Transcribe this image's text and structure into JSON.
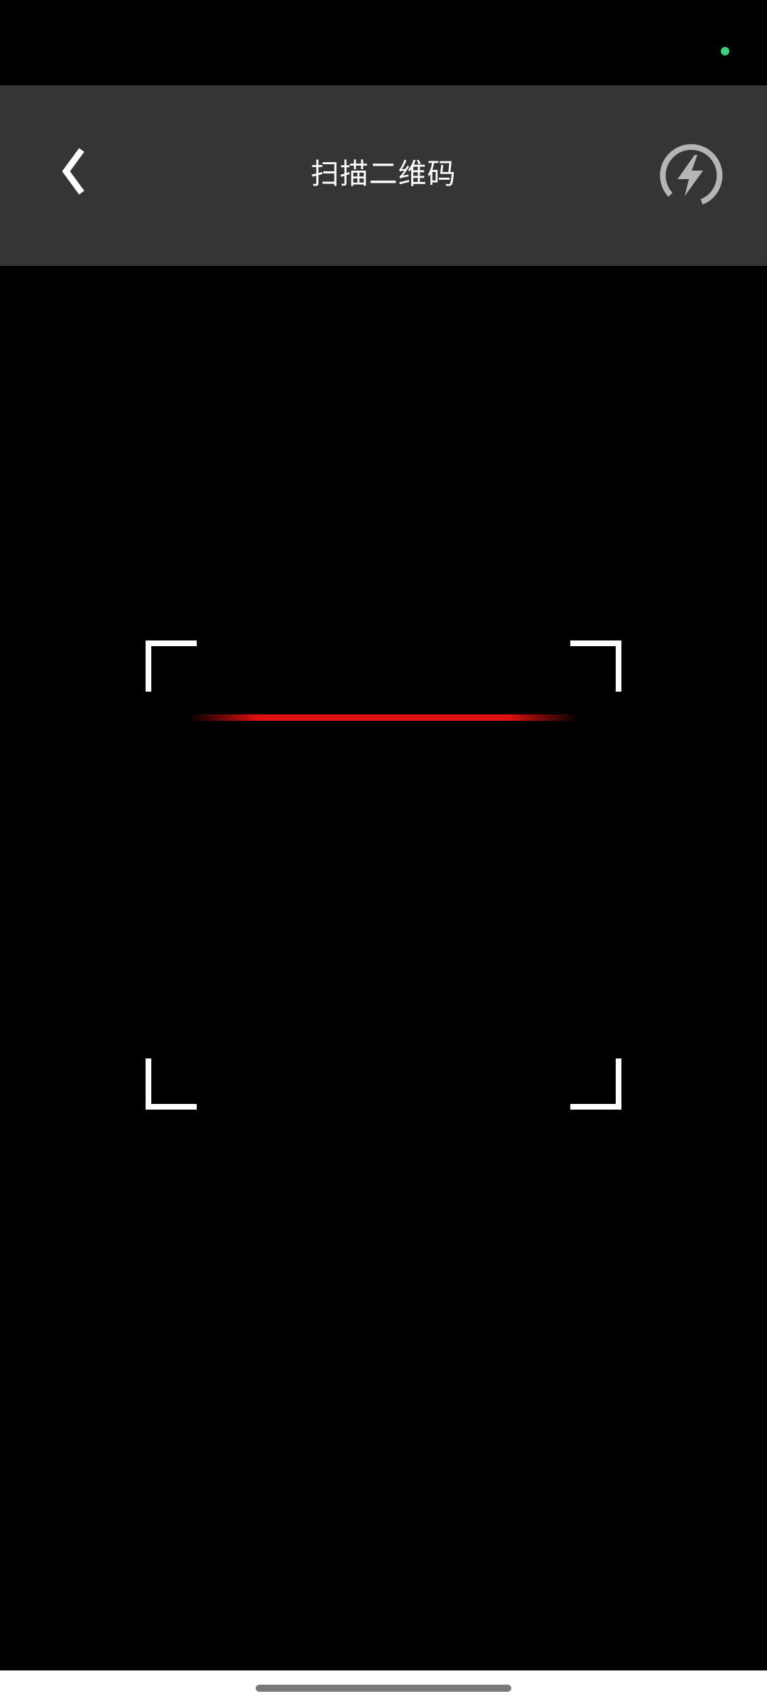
{
  "status_bar": {
    "privacy_dot_color": "#3ecf7a"
  },
  "header": {
    "background": "#353535",
    "title": "扫描二维码",
    "back_icon": "chevron-left-icon",
    "flash_icon": "flash-toggle-icon",
    "flash_icon_color": "#b5b5b5"
  },
  "scanner": {
    "frame_color": "#ffffff",
    "scan_line_color": "#e01010"
  },
  "navigation": {
    "home_indicator_color": "#7a7a7a"
  }
}
